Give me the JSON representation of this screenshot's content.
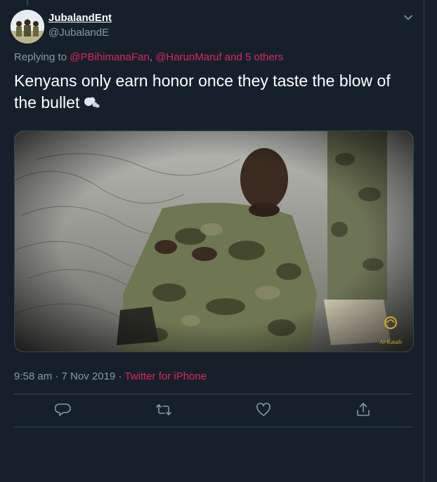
{
  "user": {
    "display_name": "JubalandEnt",
    "handle": "@JubalandE"
  },
  "reply": {
    "prefix": "Replying to",
    "mention1": "@PBihimanaFan",
    "separator": ",",
    "mention2": "@HarunMaruf",
    "and_others": "and 5 others"
  },
  "tweet": {
    "text": "Kenyans only earn honor once they taste the blow of the bullet",
    "emoji": "dashing-away"
  },
  "media": {
    "watermark_text": "Al-Kataib"
  },
  "meta": {
    "time": "9:58 am",
    "dot1": "·",
    "date": "7 Nov 2019",
    "dot2": "·",
    "source": "Twitter for iPhone"
  },
  "actions": {
    "reply_icon": "reply-icon",
    "retweet_icon": "retweet-icon",
    "like_icon": "like-icon",
    "share_icon": "share-icon"
  },
  "colors": {
    "background": "#15202b",
    "link": "#e0245e",
    "secondary_text": "#8899a6",
    "border": "#38444d"
  }
}
